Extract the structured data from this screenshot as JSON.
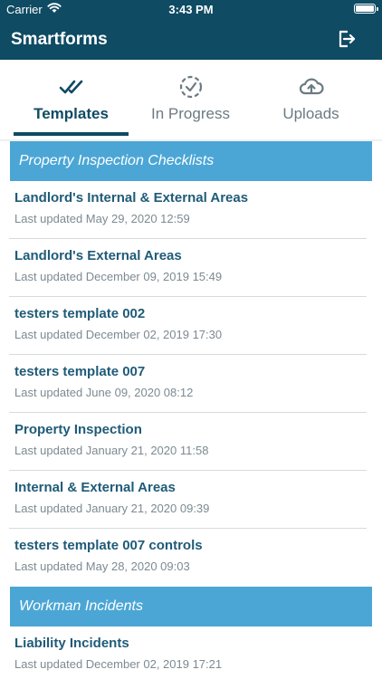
{
  "status_bar": {
    "carrier": "Carrier",
    "time": "3:43 PM"
  },
  "header": {
    "title": "Smartforms",
    "logout_icon": "logout-icon"
  },
  "tabs": [
    {
      "label": "Templates",
      "icon": "double-check-icon",
      "active": true
    },
    {
      "label": "In Progress",
      "icon": "dashed-circle-check-icon",
      "active": false
    },
    {
      "label": "Uploads",
      "icon": "cloud-upload-icon",
      "active": false
    }
  ],
  "colors": {
    "header_bg": "#0f4b63",
    "section_bg": "#4ba6d5",
    "title_text": "#1f5b78",
    "subtitle_text": "#7c8a91"
  },
  "sections": [
    {
      "title": "Property Inspection Checklists",
      "items": [
        {
          "title": "Landlord's Internal & External Areas",
          "subtitle": "Last updated May 29, 2020 12:59"
        },
        {
          "title": "Landlord's External Areas",
          "subtitle": "Last updated December 09, 2019 15:49"
        },
        {
          "title": "testers template 002",
          "subtitle": "Last updated December 02, 2019 17:30"
        },
        {
          "title": "testers template 007",
          "subtitle": "Last updated June 09, 2020 08:12"
        },
        {
          "title": "Property Inspection",
          "subtitle": "Last updated January 21, 2020 11:58"
        },
        {
          "title": "Internal & External Areas",
          "subtitle": "Last updated January 21, 2020 09:39"
        },
        {
          "title": "testers template 007 controls",
          "subtitle": "Last updated May 28, 2020 09:03"
        }
      ]
    },
    {
      "title": "Workman Incidents",
      "items": [
        {
          "title": "Liability Incidents",
          "subtitle": "Last updated December 02, 2019 17:21"
        }
      ]
    }
  ]
}
